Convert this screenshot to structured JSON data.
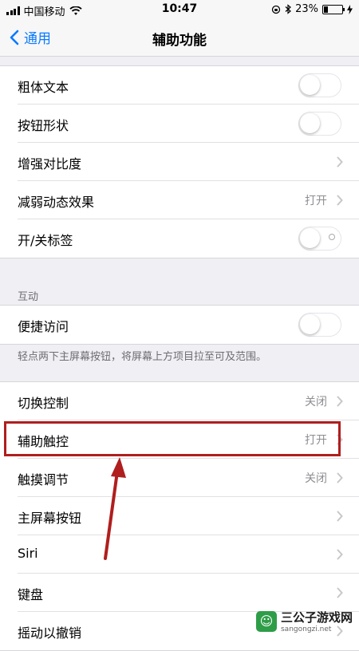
{
  "status_bar": {
    "carrier": "中国移动",
    "time": "10:47",
    "battery_percent": "23%",
    "battery_level": 0.23
  },
  "nav": {
    "back_label": "通用",
    "title": "辅助功能"
  },
  "group1": [
    {
      "label": "粗体文本",
      "control": "toggle",
      "on": false
    },
    {
      "label": "按钮形状",
      "control": "toggle",
      "on": false
    },
    {
      "label": "增强对比度",
      "control": "chevron"
    },
    {
      "label": "减弱动态效果",
      "value": "打开",
      "control": "chevron"
    },
    {
      "label": "开/关标签",
      "control": "toggle",
      "on": false
    }
  ],
  "interaction_header": "互动",
  "group2": [
    {
      "label": "便捷访问",
      "control": "toggle",
      "on": false
    }
  ],
  "group2_footer": "轻点两下主屏幕按钮，将屏幕上方项目拉至可及范围。",
  "group3": [
    {
      "label": "切换控制",
      "value": "关闭",
      "control": "chevron"
    },
    {
      "label": "辅助触控",
      "value": "打开",
      "control": "chevron"
    },
    {
      "label": "触摸调节",
      "value": "关闭",
      "control": "chevron"
    },
    {
      "label": "主屏幕按钮",
      "control": "chevron"
    },
    {
      "label": "Siri",
      "control": "chevron"
    },
    {
      "label": "键盘",
      "control": "chevron"
    },
    {
      "label": "摇动以撤销",
      "control": "chevron"
    }
  ],
  "annotation": {
    "highlight_color": "#b01e1e"
  },
  "watermark": {
    "title": "三公子游戏网",
    "url": "sangongzi.net"
  }
}
